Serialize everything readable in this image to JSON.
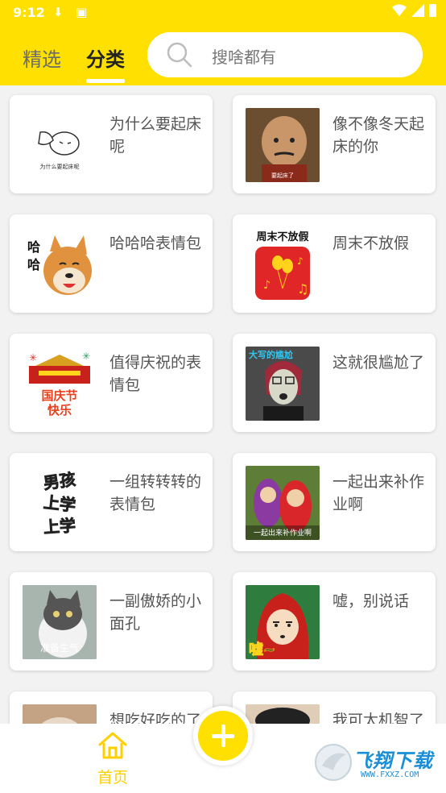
{
  "status_bar": {
    "time": "9:12"
  },
  "header": {
    "tabs": [
      {
        "label": "精选",
        "active": false
      },
      {
        "label": "分类",
        "active": true
      }
    ],
    "search": {
      "placeholder": "搜啥都有"
    },
    "accent_color": "#ffe000"
  },
  "cards": [
    {
      "title": "为什么要起床呢",
      "thumb_caption": "为什么要起床呢"
    },
    {
      "title": "像不像冬天起床的你",
      "thumb_caption": "要起床了"
    },
    {
      "title": "哈哈哈表情包",
      "thumb_caption": "哈哈"
    },
    {
      "title": "周末不放假",
      "thumb_caption": "周末不放假"
    },
    {
      "title": "值得庆祝的表情包",
      "thumb_caption": "国庆节快乐"
    },
    {
      "title": "这就很尴尬了",
      "thumb_caption": "大写的尴尬"
    },
    {
      "title": "一组转转转的表情包",
      "thumb_caption": "男孩上学"
    },
    {
      "title": "一起出来补作业啊",
      "thumb_caption": "一起出来补作业啊"
    },
    {
      "title": "一副傲娇的小面孔",
      "thumb_caption": "准备生气"
    },
    {
      "title": "嘘，别说话",
      "thumb_caption": "嘘~"
    },
    {
      "title": "想吃好吃的了",
      "thumb_caption": ""
    },
    {
      "title": "我可太机智了",
      "thumb_caption": ""
    }
  ],
  "bottom_nav": {
    "home_label": "首页",
    "fab_icon": "plus-icon"
  },
  "watermark": {
    "text": "飞翔下载",
    "url_text": "WWW.FXXZ.COM"
  }
}
